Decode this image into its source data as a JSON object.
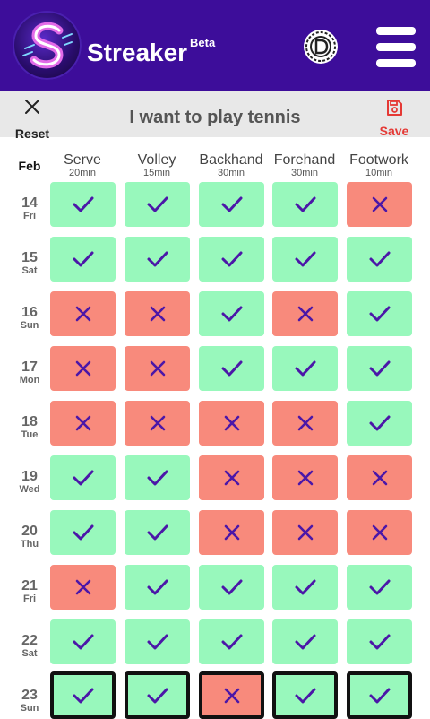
{
  "app": {
    "title": "Streaker",
    "badge": "Beta"
  },
  "toolbar": {
    "reset_label": "Reset",
    "goal": "I want to play tennis",
    "save_label": "Save"
  },
  "colors": {
    "header": "#3d0d9a",
    "done": "#98f8bc",
    "missed": "#f88a7c",
    "mark": "#4b17a8",
    "save": "#e53935"
  },
  "grid": {
    "month": "Feb",
    "columns": [
      {
        "name": "Serve",
        "duration": "20min"
      },
      {
        "name": "Volley",
        "duration": "15min"
      },
      {
        "name": "Backhand",
        "duration": "30min"
      },
      {
        "name": "Forehand",
        "duration": "30min"
      },
      {
        "name": "Footwork",
        "duration": "10min"
      }
    ],
    "rows": [
      {
        "day": "14",
        "dow": "Fri",
        "status": [
          "done",
          "done",
          "done",
          "done",
          "missed"
        ]
      },
      {
        "day": "15",
        "dow": "Sat",
        "status": [
          "done",
          "done",
          "done",
          "done",
          "done"
        ]
      },
      {
        "day": "16",
        "dow": "Sun",
        "status": [
          "missed",
          "missed",
          "done",
          "missed",
          "done"
        ]
      },
      {
        "day": "17",
        "dow": "Mon",
        "status": [
          "missed",
          "missed",
          "done",
          "done",
          "done"
        ]
      },
      {
        "day": "18",
        "dow": "Tue",
        "status": [
          "missed",
          "missed",
          "missed",
          "missed",
          "done"
        ]
      },
      {
        "day": "19",
        "dow": "Wed",
        "status": [
          "done",
          "done",
          "missed",
          "missed",
          "missed"
        ]
      },
      {
        "day": "20",
        "dow": "Thu",
        "status": [
          "done",
          "done",
          "missed",
          "missed",
          "missed"
        ]
      },
      {
        "day": "21",
        "dow": "Fri",
        "status": [
          "missed",
          "done",
          "done",
          "done",
          "done"
        ]
      },
      {
        "day": "22",
        "dow": "Sat",
        "status": [
          "done",
          "done",
          "done",
          "done",
          "done"
        ]
      },
      {
        "day": "23",
        "dow": "Sun",
        "status": [
          "done",
          "done",
          "missed",
          "done",
          "done"
        ],
        "today": true
      }
    ]
  }
}
